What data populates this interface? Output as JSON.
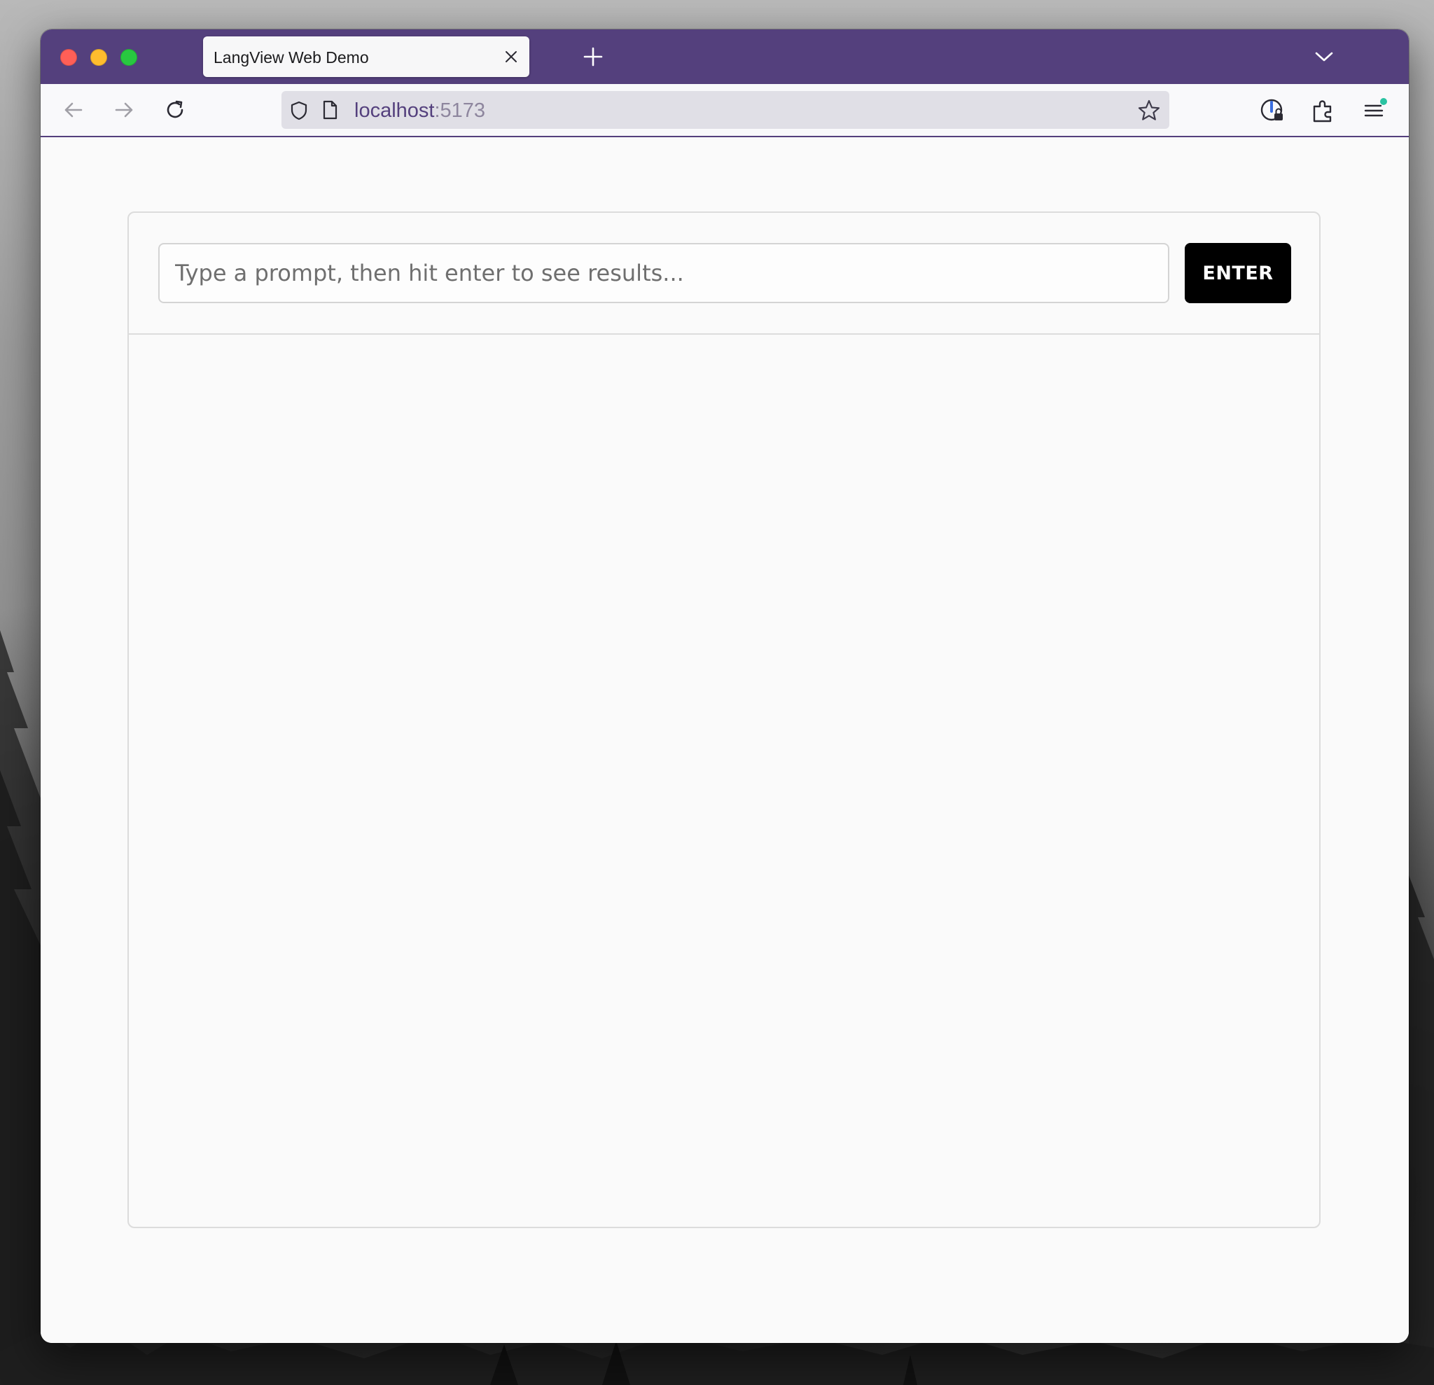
{
  "browser": {
    "tab": {
      "title": "LangView Web Demo"
    },
    "address_bar": {
      "host": "localhost",
      "port": ":5173"
    },
    "accent_color": "#54407d"
  },
  "page": {
    "prompt_input": {
      "value": "",
      "placeholder": "Type a prompt, then hit enter to see results..."
    },
    "enter_button": {
      "label": "ENTER"
    },
    "results": []
  },
  "icons": {
    "tab_close": "close-icon",
    "new_tab": "plus-icon",
    "tab_list": "chevron-down-icon",
    "back": "arrow-left-icon",
    "forward": "arrow-right-icon",
    "reload": "reload-icon",
    "tracking_protection": "shield-icon",
    "page_info": "page-icon",
    "bookmark": "star-icon",
    "vpn": "vpn-lock-icon",
    "extensions": "puzzle-icon",
    "menu": "hamburger-menu-icon"
  }
}
